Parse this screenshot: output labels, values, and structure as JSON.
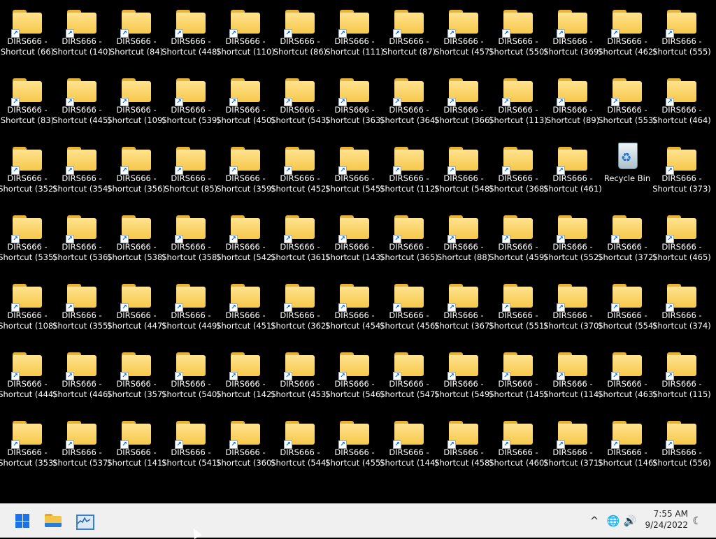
{
  "desktop": {
    "columns": 13,
    "icon_name_prefix": "DIRS666 -",
    "grid": [
      [
        "Shortcut (66)",
        "Shortcut (140)",
        "Shortcut (84)",
        "Shortcut (448)",
        "Shortcut (110)",
        "Shortcut (86)",
        "Shortcut (111)",
        "Shortcut (87)",
        "Shortcut (457)",
        "Shortcut (550)",
        "Shortcut (369)",
        "Shortcut (462)",
        "Shortcut (555)"
      ],
      [
        "Shortcut (83)",
        "Shortcut (445)",
        "Shortcut (109)",
        "Shortcut (539)",
        "Shortcut (450)",
        "Shortcut (543)",
        "Shortcut (363)",
        "Shortcut (364)",
        "Shortcut (366)",
        "Shortcut (113)",
        "Shortcut (89)",
        "Shortcut (553)",
        "Shortcut (464)"
      ],
      [
        "Shortcut (352)",
        "Shortcut (354)",
        "Shortcut (356)",
        "Shortcut (85)",
        "Shortcut (359)",
        "Shortcut (452)",
        "Shortcut (545)",
        "Shortcut (112)",
        "Shortcut (548)",
        "Shortcut (368)",
        "Shortcut (461)",
        "RECYCLE",
        "Shortcut (373)"
      ],
      [
        "Shortcut (535)",
        "Shortcut (536)",
        "Shortcut (538)",
        "Shortcut (358)",
        "Shortcut (542)",
        "Shortcut (361)",
        "Shortcut (143)",
        "Shortcut (365)",
        "Shortcut (88)",
        "Shortcut (459)",
        "Shortcut (552)",
        "Shortcut (372)",
        "Shortcut (465)"
      ],
      [
        "Shortcut (108)",
        "Shortcut (355)",
        "Shortcut (447)",
        "Shortcut (449)",
        "Shortcut (451)",
        "Shortcut (362)",
        "Shortcut (454)",
        "Shortcut (456)",
        "Shortcut (367)",
        "Shortcut (551)",
        "Shortcut (370)",
        "Shortcut (554)",
        "Shortcut (374)"
      ],
      [
        "Shortcut (444)",
        "Shortcut (446)",
        "Shortcut (357)",
        "Shortcut (540)",
        "Shortcut (142)",
        "Shortcut (453)",
        "Shortcut (546)",
        "Shortcut (547)",
        "Shortcut (549)",
        "Shortcut (145)",
        "Shortcut (114)",
        "Shortcut (463)",
        "Shortcut (115)"
      ],
      [
        "Shortcut (353)",
        "Shortcut (537)",
        "Shortcut (141)",
        "Shortcut (541)",
        "Shortcut (360)",
        "Shortcut (544)",
        "Shortcut (455)",
        "Shortcut (144)",
        "Shortcut (458)",
        "Shortcut (460)",
        "Shortcut (371)",
        "Shortcut (146)",
        "Shortcut (556)"
      ]
    ],
    "recycle_bin_label": "Recycle Bin",
    "folder_icon": "folder-shortcut-icon"
  },
  "taskbar": {
    "pinned": [
      {
        "name": "start-button",
        "icon": "windows-logo-icon"
      },
      {
        "name": "file-explorer-button",
        "icon": "folder-icon"
      },
      {
        "name": "performance-monitor-button",
        "icon": "chart-icon"
      }
    ],
    "tray": {
      "chevron": "^",
      "network": "🌐",
      "volume": "🔊",
      "focus": "☾"
    },
    "clock": {
      "time": "7:55 AM",
      "date": "9/24/2022"
    }
  }
}
